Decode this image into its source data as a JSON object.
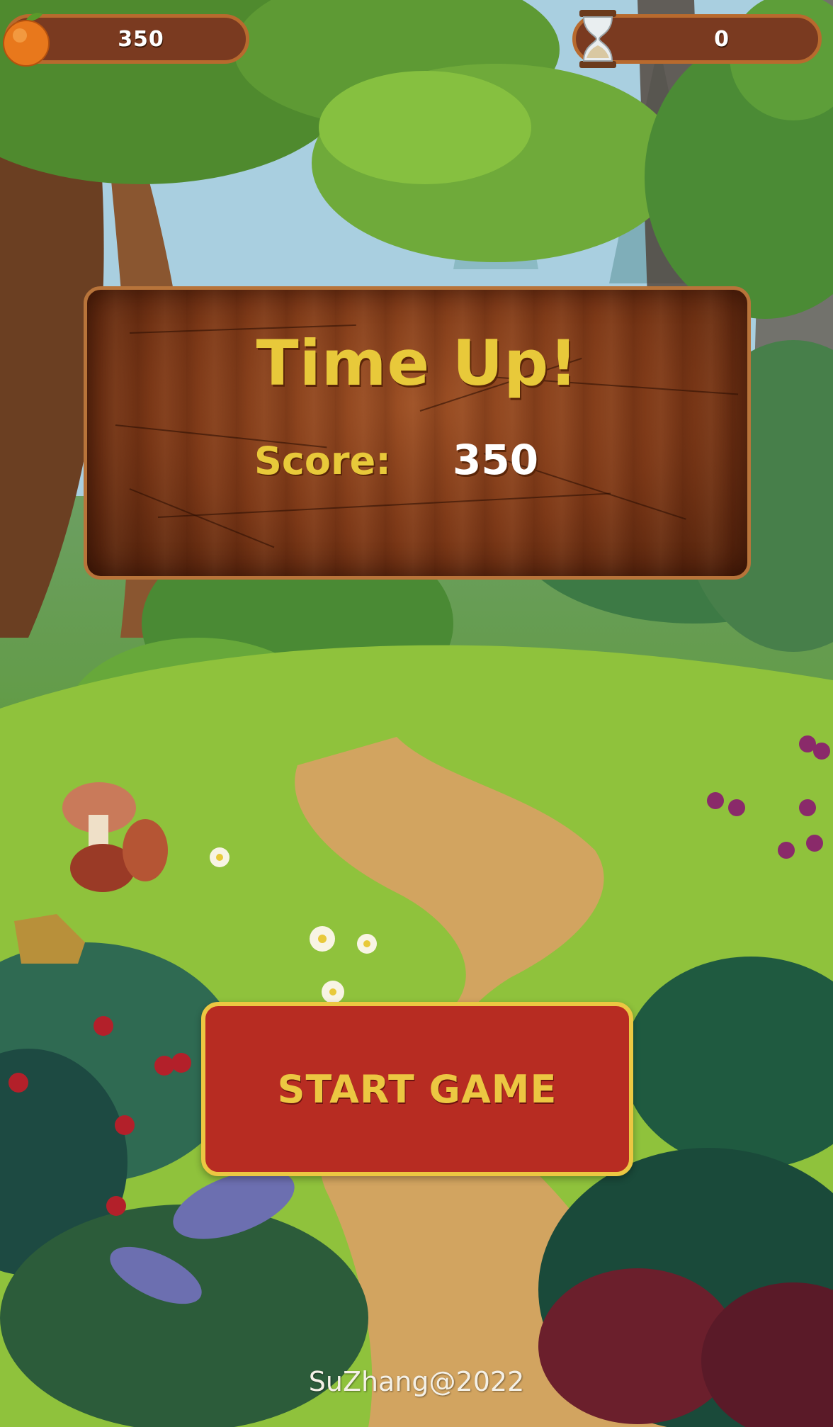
{
  "hud": {
    "fruit_icon": "orange-icon",
    "fruit_score": "350",
    "timer_icon": "hourglass-icon",
    "timer_value": "0"
  },
  "dialog": {
    "title": "Time Up!",
    "score_label": "Score:",
    "score_value": "350"
  },
  "start_button": {
    "label": "START GAME"
  },
  "footer": {
    "credit": "SuZhang@2022"
  },
  "colors": {
    "hud_pill": "#7a3a20",
    "hud_border": "#b86a2e",
    "board_border": "#b8743a",
    "title_yellow": "#e8c93a",
    "button_red": "#b72c22",
    "button_border": "#ecc742"
  }
}
